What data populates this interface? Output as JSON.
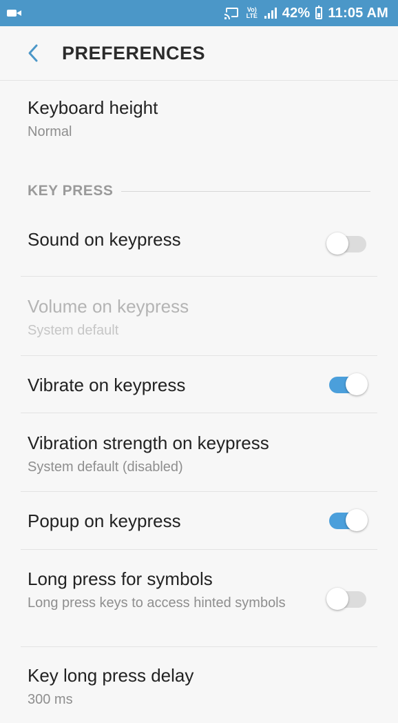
{
  "status_bar": {
    "volte_line1": "Vo)",
    "volte_line2": "LTE",
    "battery": "42%",
    "time": "11:05 AM",
    "icons": [
      "video-recording-icon",
      "screen-cast-icon",
      "volte-icon",
      "signal-icon",
      "battery-icon"
    ]
  },
  "header": {
    "title": "PREFERENCES",
    "back_icon": "chevron-left-icon"
  },
  "preferences": {
    "keyboard_height": {
      "title": "Keyboard height",
      "summary": "Normal"
    },
    "section_key_press": "KEY PRESS",
    "sound_on_keypress": {
      "title": "Sound on keypress",
      "enabled": false
    },
    "volume_on_keypress": {
      "title": "Volume on keypress",
      "summary": "System default",
      "disabled": true
    },
    "vibrate_on_keypress": {
      "title": "Vibrate on keypress",
      "enabled": true
    },
    "vibration_strength": {
      "title": "Vibration strength on keypress",
      "summary": "System default (disabled)"
    },
    "popup_on_keypress": {
      "title": "Popup on keypress",
      "enabled": true
    },
    "long_press_symbols": {
      "title": "Long press for symbols",
      "summary": "Long press keys to access hinted symbols",
      "enabled": false
    },
    "key_long_press_delay": {
      "title": "Key long press delay",
      "summary": "300 ms"
    }
  },
  "colors": {
    "status_bar": "#4b97c8",
    "accent": "#4b9fdb",
    "background": "#f7f7f7"
  }
}
